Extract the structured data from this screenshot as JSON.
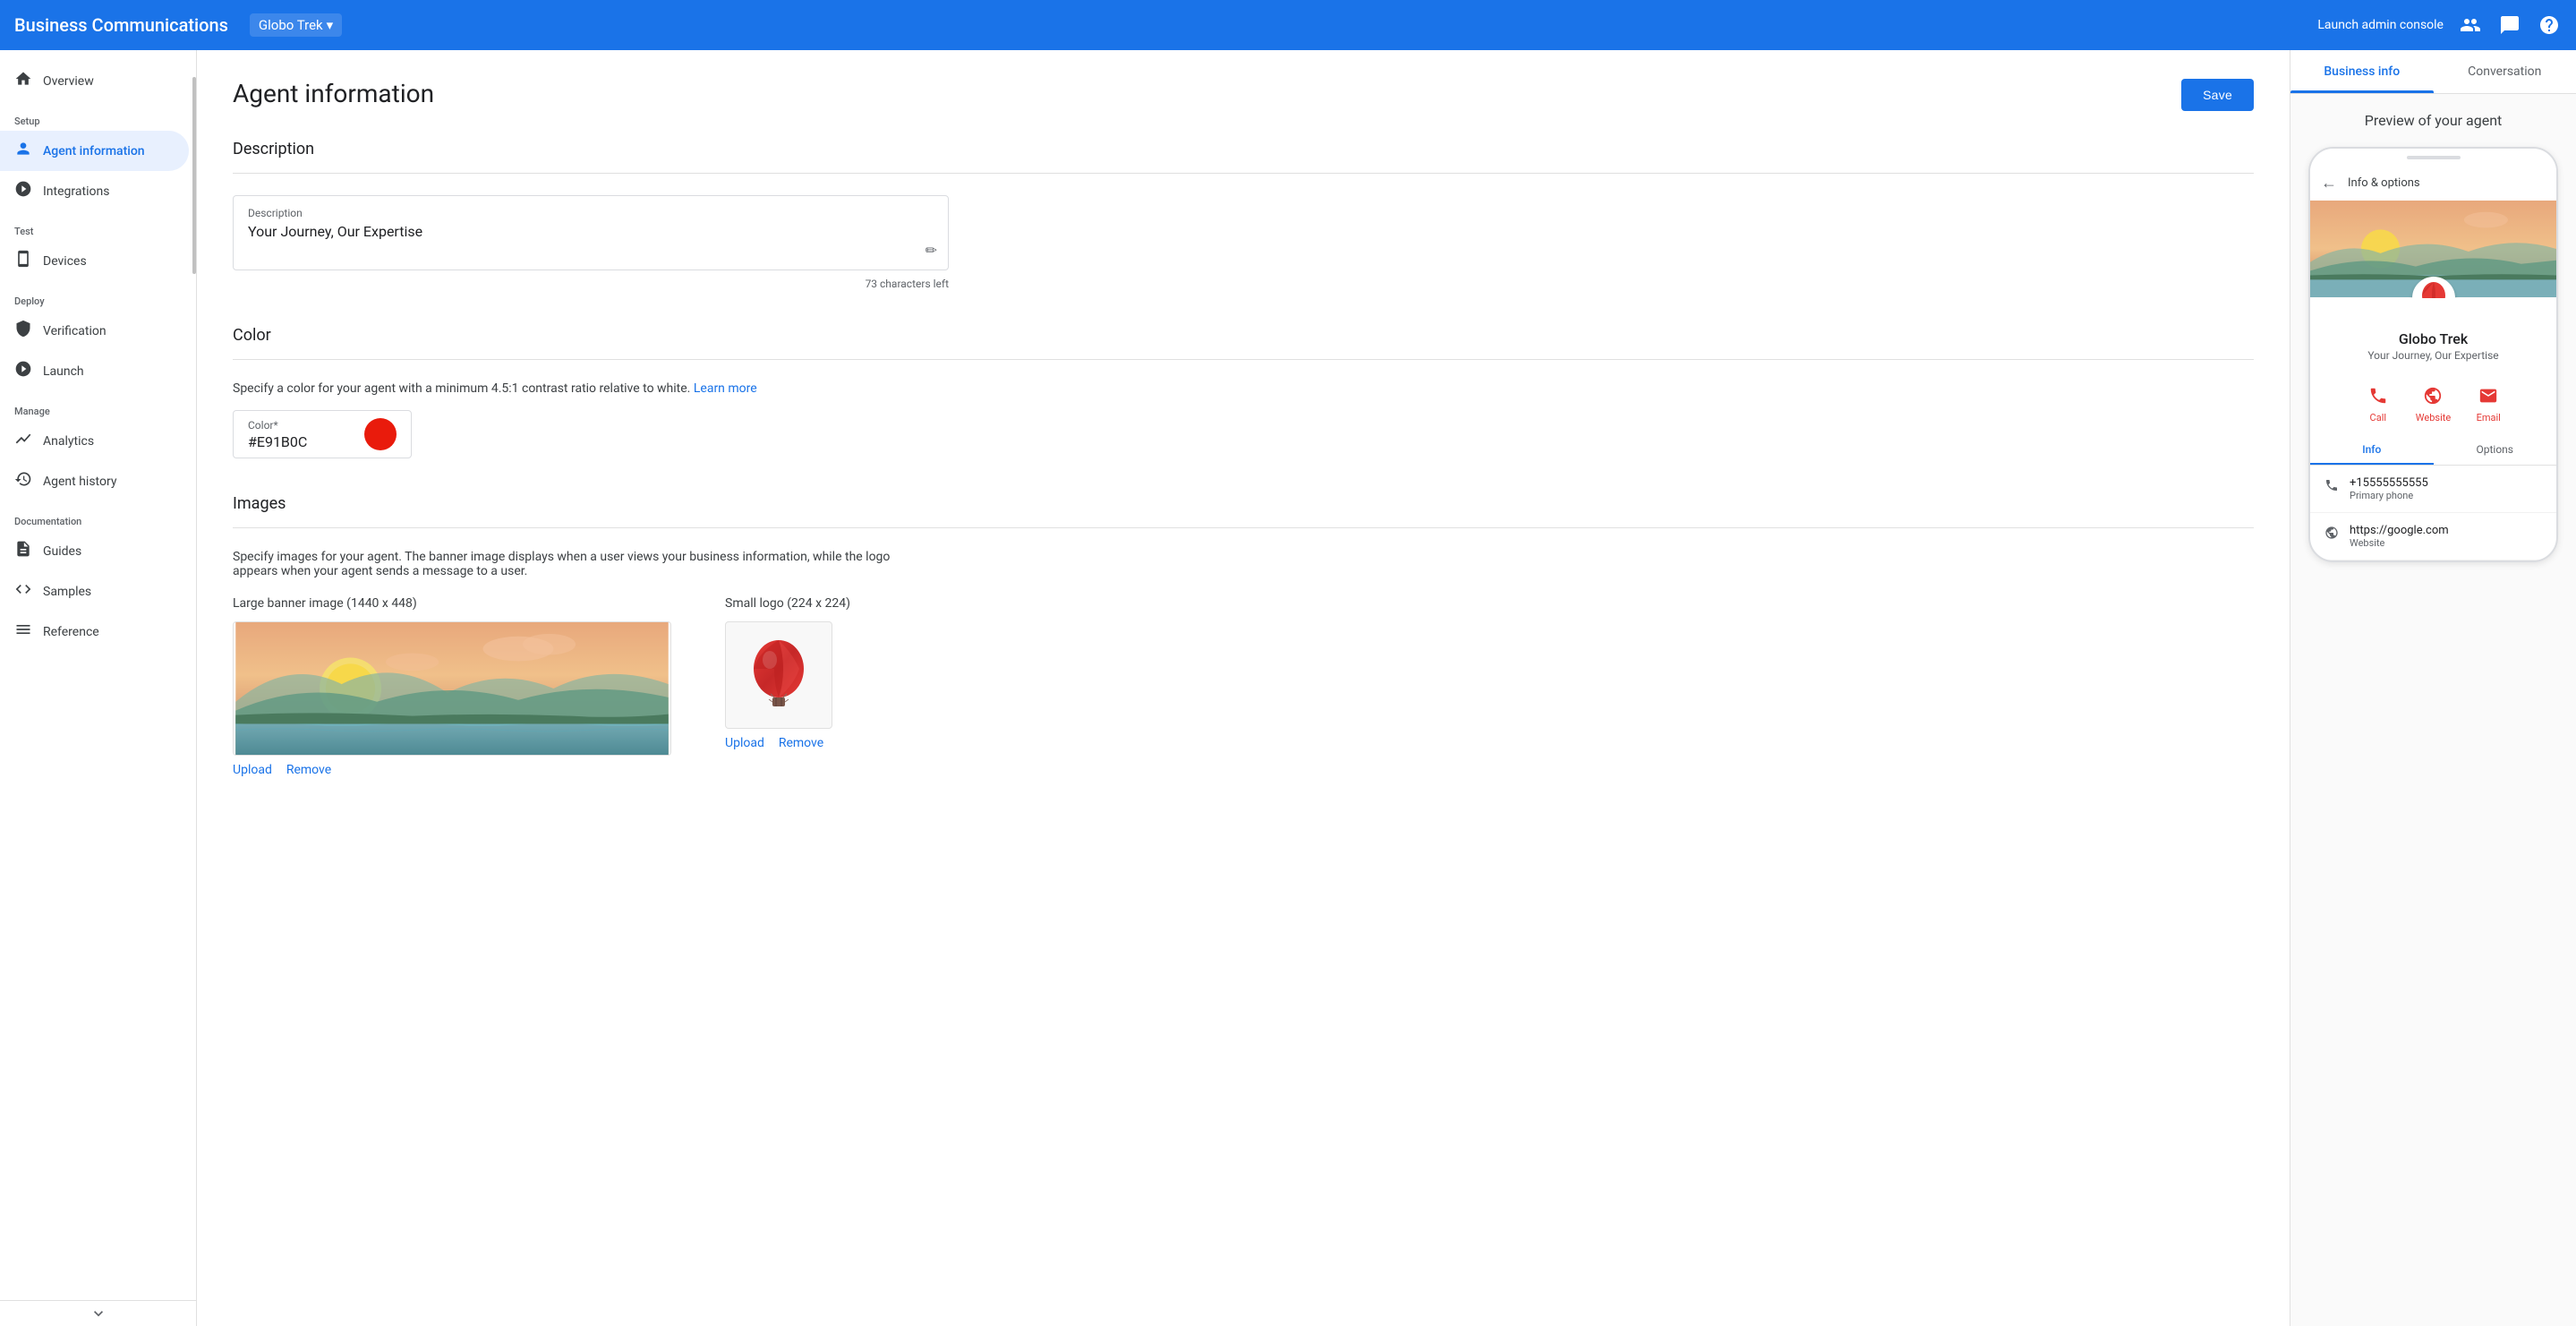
{
  "topnav": {
    "title": "Business Communications",
    "brand": "Globo Trek",
    "launch_label": "Launch admin console",
    "chevron": "▾"
  },
  "sidebar": {
    "sections": [
      {
        "label": "",
        "items": [
          {
            "id": "overview",
            "label": "Overview",
            "icon": "⌂"
          }
        ]
      },
      {
        "label": "Setup",
        "items": [
          {
            "id": "agent-information",
            "label": "Agent information",
            "icon": "👤",
            "active": true
          },
          {
            "id": "integrations",
            "label": "Integrations",
            "icon": "⚙"
          }
        ]
      },
      {
        "label": "Test",
        "items": [
          {
            "id": "devices",
            "label": "Devices",
            "icon": "📱"
          }
        ]
      },
      {
        "label": "Deploy",
        "items": [
          {
            "id": "verification",
            "label": "Verification",
            "icon": "🛡"
          },
          {
            "id": "launch",
            "label": "Launch",
            "icon": "🚀"
          }
        ]
      },
      {
        "label": "Manage",
        "items": [
          {
            "id": "analytics",
            "label": "Analytics",
            "icon": "📈"
          },
          {
            "id": "agent-history",
            "label": "Agent history",
            "icon": "🕐"
          }
        ]
      },
      {
        "label": "Documentation",
        "items": [
          {
            "id": "guides",
            "label": "Guides",
            "icon": "📄"
          },
          {
            "id": "samples",
            "label": "Samples",
            "icon": "◇"
          },
          {
            "id": "reference",
            "label": "Reference",
            "icon": "≡"
          }
        ]
      }
    ]
  },
  "page": {
    "title": "Agent information",
    "save_label": "Save"
  },
  "description": {
    "section_title": "Description",
    "label": "Description",
    "value": "Your Journey, Our Expertise",
    "chars_left": "73 characters left"
  },
  "color": {
    "section_title": "Color",
    "subtitle": "Specify a color for your agent with a minimum 4.5:1 contrast ratio relative to white.",
    "learn_more": "Learn more",
    "label": "Color*",
    "value": "#E91B0C",
    "dot_color": "#e91b0c"
  },
  "images": {
    "section_title": "Images",
    "subtitle": "Specify images for your agent. The banner image displays when a user views your business information, while the logo appears when your agent sends a message to a user.",
    "banner_label": "Large banner image (1440 x 448)",
    "logo_label": "Small logo (224 x 224)",
    "upload_label": "Upload",
    "remove_label": "Remove"
  },
  "right_panel": {
    "tabs": [
      {
        "id": "business-info",
        "label": "Business info",
        "active": true
      },
      {
        "id": "conversation",
        "label": "Conversation",
        "active": false
      }
    ],
    "preview_label": "Preview of your agent",
    "phone": {
      "nav_label": "Info & options",
      "agent_name": "Globo Trek",
      "agent_desc": "Your Journey, Our Expertise",
      "actions": [
        {
          "id": "call",
          "label": "Call",
          "color": "#e53935"
        },
        {
          "id": "website",
          "label": "Website",
          "color": "#e53935"
        },
        {
          "id": "email",
          "label": "Email",
          "color": "#e53935"
        }
      ],
      "tabs": [
        {
          "id": "info",
          "label": "Info",
          "active": true
        },
        {
          "id": "options",
          "label": "Options",
          "active": false
        }
      ],
      "info_rows": [
        {
          "icon": "📞",
          "main": "+15555555555",
          "sub": "Primary phone"
        },
        {
          "icon": "🌐",
          "main": "https://google.com",
          "sub": "Website"
        }
      ]
    }
  }
}
